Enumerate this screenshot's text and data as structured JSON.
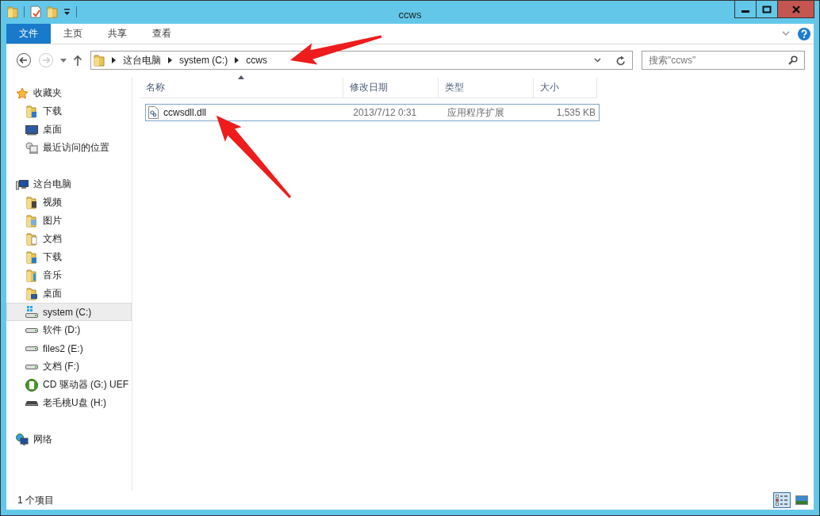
{
  "window": {
    "title": "ccws"
  },
  "ribbon_tabs": [
    {
      "label": "文件",
      "kind": "file"
    },
    {
      "label": "主页",
      "kind": "tab"
    },
    {
      "label": "共享",
      "kind": "tab"
    },
    {
      "label": "查看",
      "kind": "tab"
    }
  ],
  "address_bar": {
    "crumbs": [
      "这台电脑",
      "system (C:)",
      "ccws"
    ]
  },
  "search": {
    "placeholder": "搜索\"ccws\""
  },
  "navigation": [
    {
      "label": "收藏夹",
      "kind": "star",
      "selected": false,
      "children": [
        {
          "label": "下载",
          "kind": "folder-download",
          "selected": false
        },
        {
          "label": "桌面",
          "kind": "desktop",
          "selected": false
        },
        {
          "label": "最近访问的位置",
          "kind": "recent",
          "selected": false
        }
      ]
    },
    {
      "label": "这台电脑",
      "kind": "computer",
      "selected": false,
      "children": [
        {
          "label": "视频",
          "kind": "folder-video",
          "selected": false
        },
        {
          "label": "图片",
          "kind": "folder-picture",
          "selected": false
        },
        {
          "label": "文档",
          "kind": "folder-doc",
          "selected": false
        },
        {
          "label": "下载",
          "kind": "folder-download",
          "selected": false
        },
        {
          "label": "音乐",
          "kind": "folder-music",
          "selected": false
        },
        {
          "label": "桌面",
          "kind": "folder-desktop",
          "selected": false
        },
        {
          "label": "system (C:)",
          "kind": "drive-system",
          "selected": true
        },
        {
          "label": "软件 (D:)",
          "kind": "drive",
          "selected": false
        },
        {
          "label": "files2 (E:)",
          "kind": "drive",
          "selected": false
        },
        {
          "label": "文档 (F:)",
          "kind": "drive",
          "selected": false
        },
        {
          "label": "CD 驱动器 (G:) UEF",
          "kind": "cd",
          "selected": false
        },
        {
          "label": "老毛桃U盘 (H:)",
          "kind": "usb",
          "selected": false
        }
      ]
    },
    {
      "label": "网络",
      "kind": "network",
      "selected": false
    }
  ],
  "table": {
    "columns": [
      {
        "label": "名称",
        "sorted": true
      },
      {
        "label": "修改日期",
        "sorted": false
      },
      {
        "label": "类型",
        "sorted": false
      },
      {
        "label": "大小",
        "sorted": false
      }
    ],
    "rows": [
      {
        "name": "ccwsdll.dll",
        "modified": "2013/7/12 0:31",
        "type": "应用程序扩展",
        "size": "1,535 KB",
        "focused": true
      }
    ]
  },
  "status_bar": {
    "text": "1 个项目",
    "views": [
      {
        "kind": "details",
        "selected": true
      },
      {
        "kind": "large-icons",
        "selected": false
      }
    ]
  }
}
